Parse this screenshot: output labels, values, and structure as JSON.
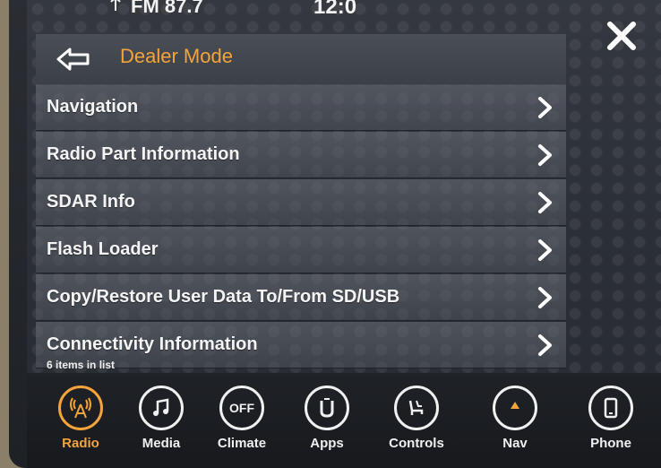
{
  "status": {
    "source": "FM 87.7",
    "clock": "12:0"
  },
  "header": {
    "title": "Dealer Mode"
  },
  "list": {
    "items": [
      {
        "label": "Navigation"
      },
      {
        "label": "Radio Part Information"
      },
      {
        "label": "SDAR Info"
      },
      {
        "label": "Flash Loader"
      },
      {
        "label": "Copy/Restore User Data To/From SD/USB"
      },
      {
        "label": "Connectivity Information"
      }
    ],
    "count_text": "6 items in list"
  },
  "dock": {
    "items": [
      {
        "label": "Radio",
        "icon": "radio-tower-icon",
        "active": true
      },
      {
        "label": "Media",
        "icon": "music-note-icon"
      },
      {
        "label": "Climate",
        "icon": "climate-off-icon",
        "icon_text": "OFF"
      },
      {
        "label": "Apps",
        "icon": "apps-icon"
      },
      {
        "label": "Controls",
        "icon": "seat-controls-icon"
      },
      {
        "label": "Nav",
        "icon": "compass-icon"
      },
      {
        "label": "Phone",
        "icon": "phone-icon"
      }
    ]
  },
  "colors": {
    "accent": "#f3a43a",
    "text": "#f4f4f4"
  }
}
